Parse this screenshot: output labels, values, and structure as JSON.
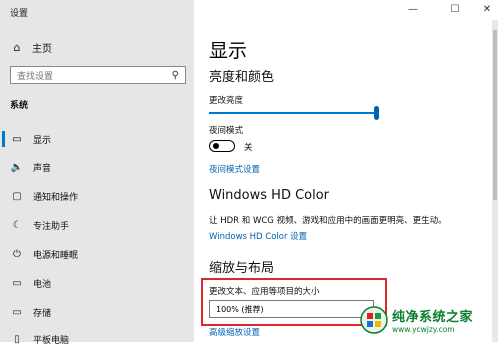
{
  "window": {
    "title": "设置",
    "minimize": "—",
    "maximize": "☐",
    "close": "✕"
  },
  "sidebar": {
    "home_label": "主页",
    "search_placeholder": "查找设置",
    "section_label": "系统",
    "items": [
      {
        "label": "显示",
        "icon": "▭"
      },
      {
        "label": "声音",
        "icon": "🔈"
      },
      {
        "label": "通知和操作",
        "icon": "▢"
      },
      {
        "label": "专注助手",
        "icon": "☾"
      },
      {
        "label": "电源和睡眠",
        "icon": "⏻"
      },
      {
        "label": "电池",
        "icon": "▭"
      },
      {
        "label": "存储",
        "icon": "▭"
      },
      {
        "label": "平板电脑",
        "icon": "▯"
      }
    ]
  },
  "main": {
    "page_title": "显示",
    "brightness_section": {
      "heading": "亮度和颜色",
      "brightness_label": "更改亮度",
      "brightness_value": 1.0,
      "night_mode_label": "夜间模式",
      "night_mode_state": "关",
      "night_mode_link": "夜间模式设置"
    },
    "hdr_section": {
      "heading": "Windows HD Color",
      "description": "让 HDR 和 WCG 视频、游戏和应用中的画面更明亮、更生动。",
      "link": "Windows HD Color 设置"
    },
    "scale_section": {
      "heading": "缩放与布局",
      "scale_label": "更改文本、应用等项目的大小",
      "scale_value": "100% (推荐)",
      "advanced_link": "高级缩放设置"
    }
  },
  "watermark": {
    "title": "纯净系统之家",
    "url": "www.ycwjzy.com"
  }
}
